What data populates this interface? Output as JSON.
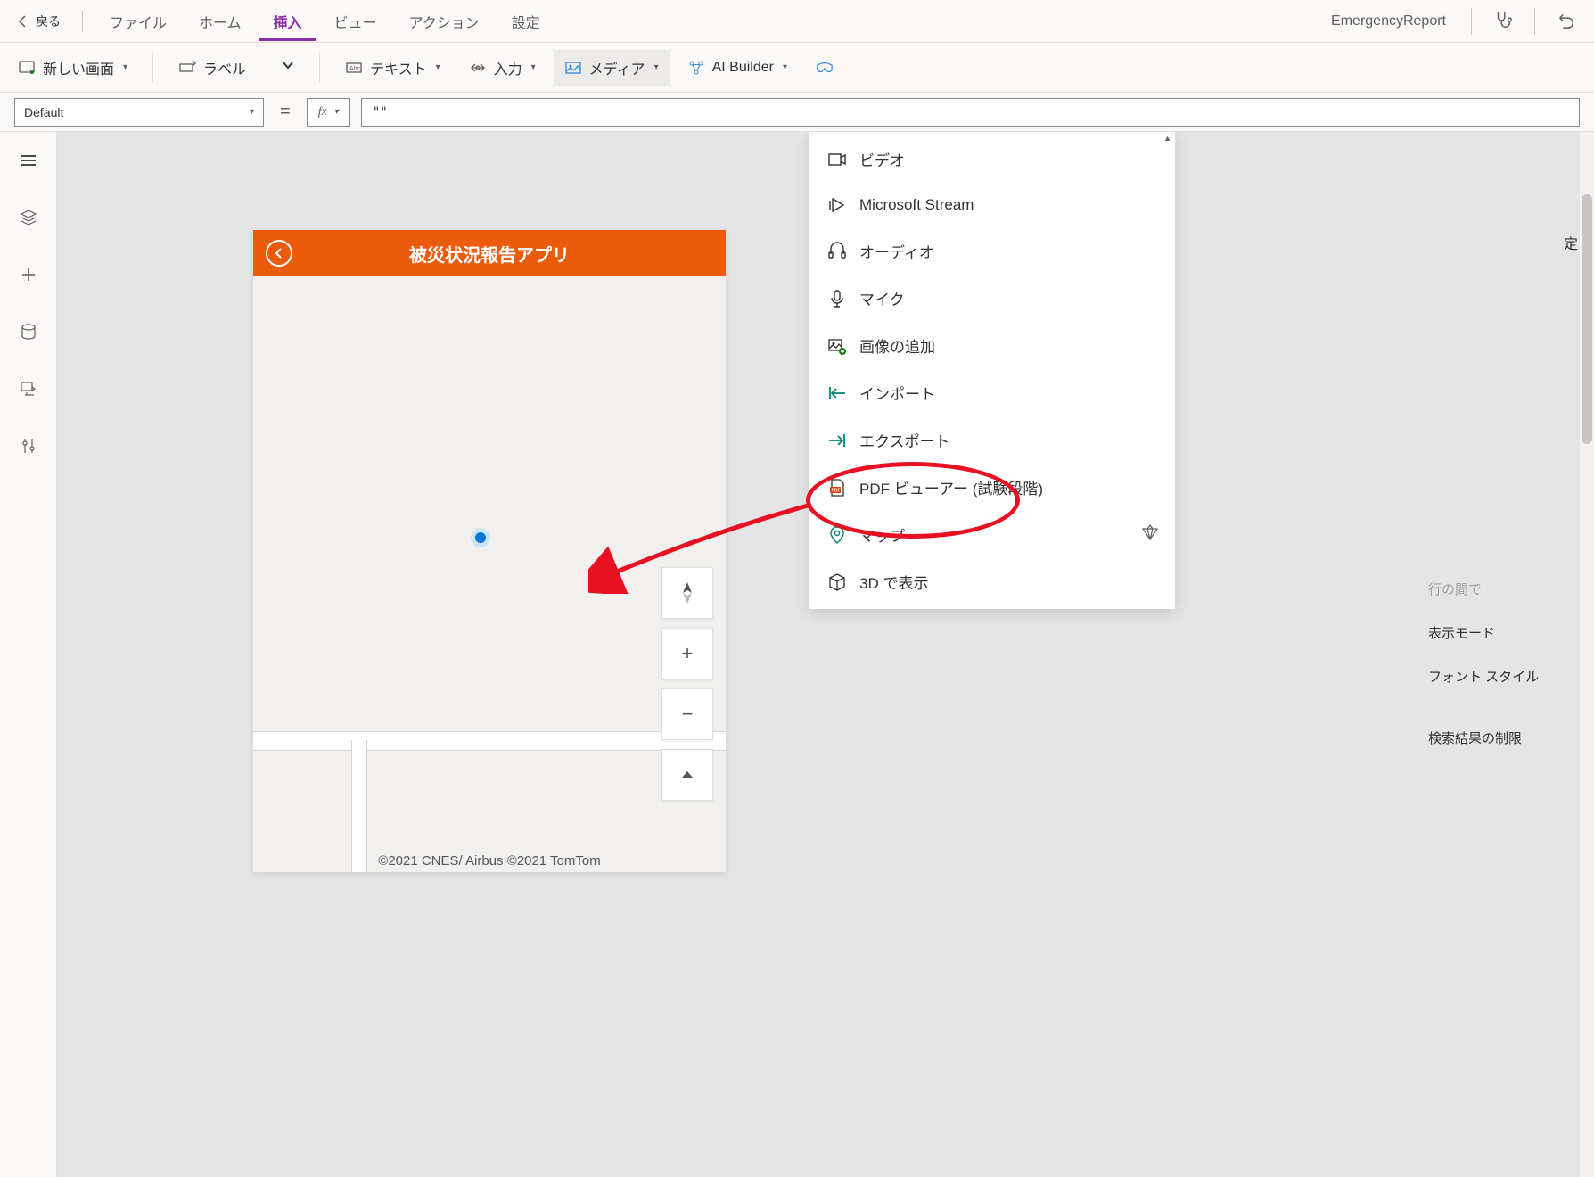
{
  "menubar": {
    "back": "戻る",
    "items": [
      {
        "label": "ファイル"
      },
      {
        "label": "ホーム"
      },
      {
        "label": "挿入",
        "active": true
      },
      {
        "label": "ビュー"
      },
      {
        "label": "アクション"
      },
      {
        "label": "設定"
      }
    ],
    "app_name": "EmergencyReport"
  },
  "ribbon": {
    "new_screen": "新しい画面",
    "label_btn": "ラベル",
    "text_btn": "テキスト",
    "input_btn": "入力",
    "media_btn": "メディア",
    "ai_builder": "AI Builder"
  },
  "formula": {
    "property": "Default",
    "value": "\"\""
  },
  "phone": {
    "title": "被災状況報告アプリ",
    "attrib": "©2021 CNES/ Airbus  ©2021 TomTom"
  },
  "dropdown": {
    "items": [
      {
        "icon": "video",
        "label": "ビデオ"
      },
      {
        "icon": "stream",
        "label": "Microsoft Stream"
      },
      {
        "icon": "audio",
        "label": "オーディオ"
      },
      {
        "icon": "mic",
        "label": "マイク"
      },
      {
        "icon": "add-image",
        "label": "画像の追加"
      },
      {
        "icon": "import",
        "label": "インポート"
      },
      {
        "icon": "export",
        "label": "エクスポート"
      },
      {
        "icon": "pdf",
        "label": "PDF ビューアー (試験段階)"
      },
      {
        "icon": "map",
        "label": "マップ",
        "premium": true,
        "highlighted": true
      },
      {
        "icon": "3d",
        "label": "3D で表示"
      }
    ]
  },
  "right_panel": {
    "partial_header": "定",
    "partial_top": "行の間で",
    "display_mode": "表示モード",
    "font_style": "フォント スタイル",
    "search_limit": "検索結果の制限"
  },
  "map_controls": {
    "compass": "◆",
    "zoom_in": "+",
    "zoom_out": "−",
    "fit": "▔"
  },
  "colors": {
    "accent": "#8a2da5",
    "orange": "#eb5b0c",
    "annotation": "#e81123"
  }
}
